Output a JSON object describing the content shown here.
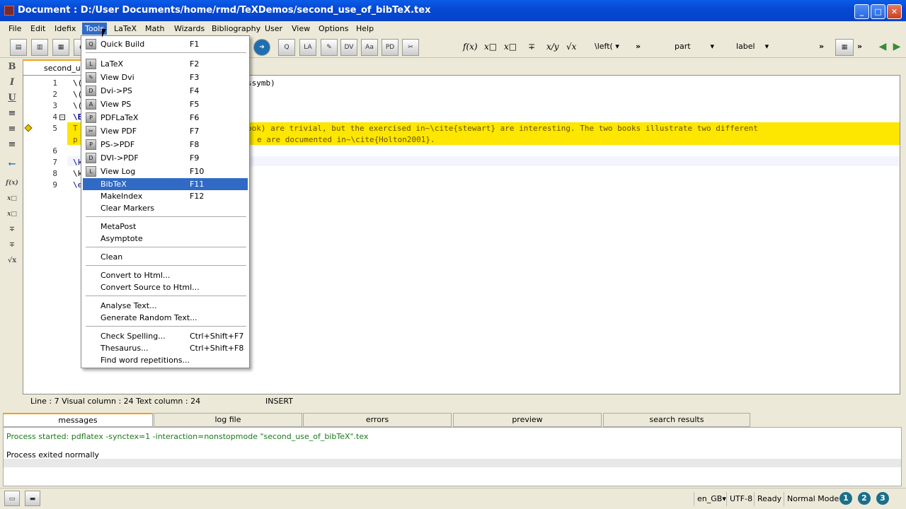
{
  "window": {
    "title": "Document : D:/User Documents/home/rmd/TeXDemos/second_use_of_bibTeX.tex",
    "min": "_",
    "max": "□",
    "close": "✕"
  },
  "menubar": [
    "File",
    "Edit",
    "Idefix",
    "Tools",
    "LaTeX",
    "Math",
    "Wizards",
    "Bibliography",
    "User",
    "View",
    "Options",
    "Help"
  ],
  "toolbar": {
    "math": [
      "f(x)",
      "x□",
      "x□",
      "∓",
      "x/y",
      "√x"
    ],
    "left_combo": "\\left(",
    "more1": "»",
    "part_combo": "part",
    "label_combo": "label",
    "more2": "»",
    "more3": "»"
  },
  "sidebar": [
    "B",
    "I",
    "U",
    "≡",
    "≡",
    "≡",
    "←",
    "f(x)",
    "x□",
    "x□",
    "∓",
    "∓",
    "√x"
  ],
  "tab": {
    "label": "second_us"
  },
  "editor": {
    "line_numbers": [
      "1",
      "2",
      "3",
      "4",
      "5",
      "6",
      "7",
      "8",
      "9"
    ],
    "lines": [
      "\\(",
      "\\(",
      "\\(",
      "\\E",
      "T",
      "p",
      "",
      "\\k",
      "\\k",
      "\\e"
    ],
    "line1_tail": "ssymb)",
    "line5_tail": "ook) are trivial, but the exercised in~\\cite{stewart} are interesting. The two books illustrate two different",
    "line6_tail": "e are documented in~\\cite{Holton2001}."
  },
  "status_line": {
    "position": "Line : 7 Visual column : 24 Text column : 24",
    "mode": "INSERT"
  },
  "bottom_tabs": [
    "messages",
    "log file",
    "errors",
    "preview",
    "search results"
  ],
  "messages": {
    "started": "Process started: pdflatex -synctex=1 -interaction=nonstopmode \"second_use_of_bibTeX\".tex",
    "exited": "Process exited normally"
  },
  "statusbar": {
    "lang": "en_GB",
    "encoding": "UTF-8",
    "status": "Ready",
    "mode": "Normal Mode",
    "views": [
      "1",
      "2",
      "3"
    ]
  },
  "tools_menu": {
    "items": [
      {
        "label": "Quick Build",
        "shortcut": "F1"
      },
      {
        "label": "LaTeX",
        "shortcut": "F2"
      },
      {
        "label": "View Dvi",
        "shortcut": "F3"
      },
      {
        "label": "Dvi->PS",
        "shortcut": "F4"
      },
      {
        "label": "View PS",
        "shortcut": "F5"
      },
      {
        "label": "PDFLaTeX",
        "shortcut": "F6"
      },
      {
        "label": "View PDF",
        "shortcut": "F7"
      },
      {
        "label": "PS->PDF",
        "shortcut": "F8"
      },
      {
        "label": "DVI->PDF",
        "shortcut": "F9"
      },
      {
        "label": "View Log",
        "shortcut": "F10"
      },
      {
        "label": "BibTeX",
        "shortcut": "F11"
      },
      {
        "label": "MakeIndex",
        "shortcut": "F12"
      },
      {
        "label": "Clear Markers",
        "shortcut": ""
      },
      {
        "label": "MetaPost",
        "shortcut": ""
      },
      {
        "label": "Asymptote",
        "shortcut": ""
      },
      {
        "label": "Clean",
        "shortcut": ""
      },
      {
        "label": "Convert to Html...",
        "shortcut": ""
      },
      {
        "label": "Convert Source to Html...",
        "shortcut": ""
      },
      {
        "label": "Analyse Text...",
        "shortcut": ""
      },
      {
        "label": "Generate Random Text...",
        "shortcut": ""
      },
      {
        "label": "Check Spelling...",
        "shortcut": "Ctrl+Shift+F7"
      },
      {
        "label": "Thesaurus...",
        "shortcut": "Ctrl+Shift+F8"
      },
      {
        "label": "Find word repetitions...",
        "shortcut": ""
      }
    ]
  }
}
